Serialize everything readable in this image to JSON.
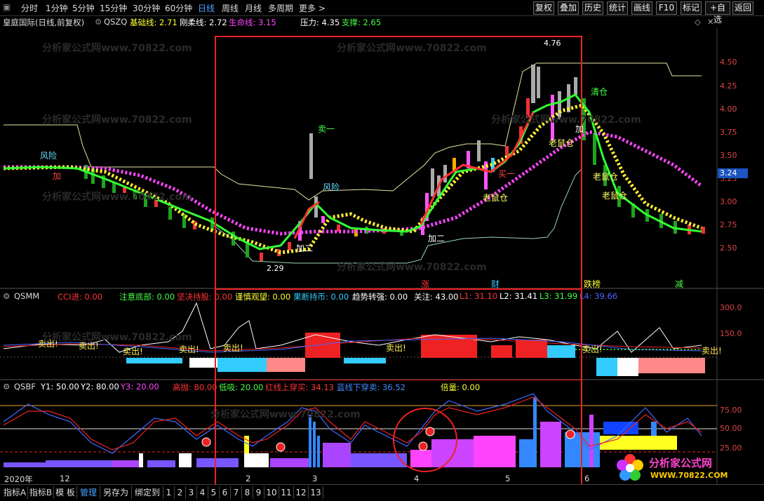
{
  "top_tabs": [
    "分时",
    "1分钟",
    "5分钟",
    "15分钟",
    "30分钟",
    "60分钟",
    "日线",
    "周线",
    "月线",
    "多周期",
    "更多 >"
  ],
  "top_buttons": [
    "复权",
    "叠加",
    "历史",
    "统计",
    "画线",
    "F10",
    "标记",
    "+自选",
    "返回"
  ],
  "main_header": {
    "stock": "皇庭国际(日线,前复权)",
    "formula": "QSZQ",
    "items": [
      {
        "label": "基础线: 2.71",
        "color": "#ffff33"
      },
      {
        "label": "刚柔线: 2.72",
        "color": "#ffffff"
      },
      {
        "label": "生命线: 3.15",
        "color": "#ff44ff"
      },
      {
        "label": "压力: 4.35",
        "color": "#ffffff"
      },
      {
        "label": "支撑: 2.65",
        "color": "#44ff44"
      }
    ]
  },
  "main_axis": [
    "4.50",
    "4.25",
    "4.00",
    "3.75",
    "3.50",
    "3.25",
    "3.00",
    "2.75",
    "2.50"
  ],
  "price_tag": "3.24",
  "annotations": {
    "high": "4.76",
    "low": "2.29",
    "risk1": "风险",
    "risk2": "风险",
    "sell1": "卖一",
    "clear": "清仓",
    "add2": "加二",
    "add2b": "加二",
    "buy1": "买一",
    "rat1": "老鼠仓",
    "rat2": "老鼠仓",
    "rat3": "老鼠仓",
    "rat4": "老鼠仓",
    "add": "加",
    "addb": "加"
  },
  "main_marks": [
    {
      "label": "涨",
      "color": "#ff3333"
    },
    {
      "label": "财",
      "color": "#33ccff"
    },
    {
      "label": "跌榜",
      "color": "#ffff33"
    },
    {
      "label": "减",
      "color": "#44ff44"
    }
  ],
  "mid_header": {
    "formula": "QSMM",
    "items": [
      {
        "label": "CCI进: 0.00",
        "color": "#ff3333"
      },
      {
        "label": "注意底部: 0.00",
        "color": "#44ff44"
      },
      {
        "label": "坚决持股: 0.00",
        "color": "#ff3333"
      },
      {
        "label": "谨慎观望: 0.00",
        "color": "#ffff33"
      },
      {
        "label": "果断持币: 0.00",
        "color": "#33ccff"
      },
      {
        "label": "趋势转强: 0.00",
        "color": "#ffffff"
      },
      {
        "label": "关注: 43.00",
        "color": "#ffffff"
      },
      {
        "label": "L1: 31.10",
        "color": "#ff3333"
      },
      {
        "label": "L2: 31.41",
        "color": "#ffffff"
      },
      {
        "label": "L3: 31.99",
        "color": "#44ff44"
      },
      {
        "label": "L4: 39.66",
        "color": "#4466ff"
      }
    ]
  },
  "mid_axis": [
    "300.0",
    "150.0"
  ],
  "mid_sell_label": "卖出!",
  "bot_header": {
    "formula": "QSBF",
    "items": [
      {
        "label": "Y1: 50.00",
        "color": "#ffffff"
      },
      {
        "label": "Y2: 80.00",
        "color": "#ffffff"
      },
      {
        "label": "Y3: 20.00",
        "color": "#ff44ff"
      },
      {
        "label": "高抛: 80.00",
        "color": "#ff3333"
      },
      {
        "label": "低吸: 20.00",
        "color": "#44ff44"
      },
      {
        "label": "红线上穿买: 34.13",
        "color": "#ff3333"
      },
      {
        "label": "蓝线下穿卖: 36.52",
        "color": "#4488ff"
      },
      {
        "label": "倍量: 0.00",
        "color": "#ffff33"
      }
    ]
  },
  "bot_axis": [
    "75.00",
    "50.00",
    "25.00"
  ],
  "time_axis": [
    {
      "label": "2020年"
    },
    {
      "label": "12"
    },
    {
      "label": "2"
    },
    {
      "label": "3"
    },
    {
      "label": "4"
    },
    {
      "label": "5"
    },
    {
      "label": "6"
    }
  ],
  "watermark": "分析家公式网www.70822.com",
  "logo": {
    "title": "分析家公式网",
    "url": "WWW.70822.COM"
  },
  "bottom_tabs": [
    "指标A",
    "指标B",
    "模 板",
    "管理",
    "另存为",
    "绑定到",
    "1",
    "2",
    "3",
    "4",
    "5",
    "6",
    "7",
    "8",
    "9",
    "10",
    "11",
    "12",
    "13"
  ]
}
